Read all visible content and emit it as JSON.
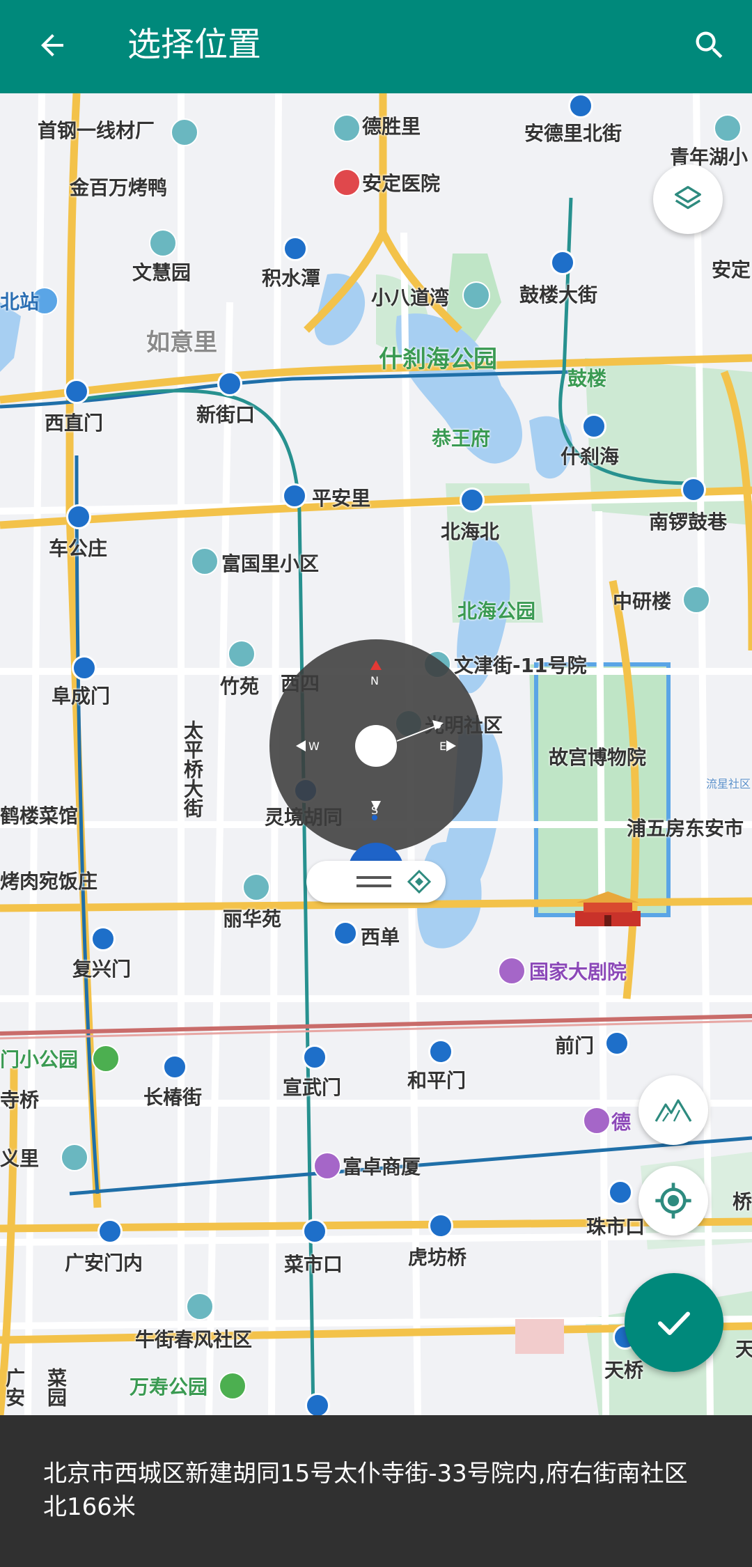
{
  "app_bar": {
    "title": "选择位置",
    "back_icon": "arrow-left-icon",
    "search_icon": "search-icon"
  },
  "map": {
    "labels": [
      {
        "text": "首钢一线材厂",
        "cls": ""
      },
      {
        "text": "德胜里",
        "cls": ""
      },
      {
        "text": "安德里北街",
        "cls": ""
      },
      {
        "text": "青年湖小",
        "cls": ""
      },
      {
        "text": "金百万烤鸭",
        "cls": ""
      },
      {
        "text": "安定医院",
        "cls": ""
      },
      {
        "text": "文慧园",
        "cls": ""
      },
      {
        "text": "积水潭",
        "cls": ""
      },
      {
        "text": "小八道湾",
        "cls": ""
      },
      {
        "text": "鼓楼大街",
        "cls": ""
      },
      {
        "text": "安定",
        "cls": ""
      },
      {
        "text": "北站",
        "cls": "blue"
      },
      {
        "text": "如意里",
        "cls": "gray"
      },
      {
        "text": "什刹海公园",
        "cls": "green big"
      },
      {
        "text": "鼓楼",
        "cls": "green"
      },
      {
        "text": "西直门",
        "cls": ""
      },
      {
        "text": "新街口",
        "cls": ""
      },
      {
        "text": "恭王府",
        "cls": "green"
      },
      {
        "text": "什刹海",
        "cls": ""
      },
      {
        "text": "平安里",
        "cls": ""
      },
      {
        "text": "北海北",
        "cls": ""
      },
      {
        "text": "南锣鼓巷",
        "cls": ""
      },
      {
        "text": "车公庄",
        "cls": ""
      },
      {
        "text": "富国里小区",
        "cls": ""
      },
      {
        "text": "北海公园",
        "cls": "green"
      },
      {
        "text": "中研楼",
        "cls": ""
      },
      {
        "text": "竹苑",
        "cls": ""
      },
      {
        "text": "西四",
        "cls": ""
      },
      {
        "text": "文津街-11号院",
        "cls": ""
      },
      {
        "text": "阜成门",
        "cls": ""
      },
      {
        "text": "光明社区",
        "cls": ""
      },
      {
        "text": "故宫博物院",
        "cls": ""
      },
      {
        "text": "太平桥大街",
        "cls": "vert"
      },
      {
        "text": "鹤楼菜馆",
        "cls": ""
      },
      {
        "text": "灵境胡同",
        "cls": ""
      },
      {
        "text": "浦五房东安市",
        "cls": ""
      },
      {
        "text": "流星社区",
        "cls": "small-blue"
      },
      {
        "text": "烤肉宛饭庄",
        "cls": ""
      },
      {
        "text": "丽华苑",
        "cls": ""
      },
      {
        "text": "西单",
        "cls": ""
      },
      {
        "text": "复兴门",
        "cls": ""
      },
      {
        "text": "国家大剧院",
        "cls": "purple"
      },
      {
        "text": "门小公园",
        "cls": "green"
      },
      {
        "text": "长椿街",
        "cls": ""
      },
      {
        "text": "宣武门",
        "cls": ""
      },
      {
        "text": "和平门",
        "cls": ""
      },
      {
        "text": "前门",
        "cls": ""
      },
      {
        "text": "寺桥",
        "cls": ""
      },
      {
        "text": "德",
        "cls": "purple"
      },
      {
        "text": "义里",
        "cls": ""
      },
      {
        "text": "富卓商厦",
        "cls": ""
      },
      {
        "text": "珠市口",
        "cls": ""
      },
      {
        "text": "桥",
        "cls": ""
      },
      {
        "text": "广安门内",
        "cls": ""
      },
      {
        "text": "菜市口",
        "cls": ""
      },
      {
        "text": "虎坊桥",
        "cls": ""
      },
      {
        "text": "牛街春风社区",
        "cls": ""
      },
      {
        "text": "天桥",
        "cls": ""
      },
      {
        "text": "天",
        "cls": ""
      },
      {
        "text": "万寿公园",
        "cls": "green"
      },
      {
        "text": "广安",
        "cls": ""
      },
      {
        "text": "菜园",
        "cls": ""
      }
    ],
    "compass": {
      "north": "N",
      "south": "S",
      "east": "E",
      "west": "W"
    },
    "layers_icon": "layers-icon",
    "terrain_icon": "terrain-icon",
    "locate_icon": "my-location-icon",
    "confirm_icon": "check-icon"
  },
  "bottom_bar": {
    "address": "北京市西城区新建胡同15号太仆寺街-33号院内,府右街南社区北166米"
  },
  "colors": {
    "primary": "#00897b",
    "bottom": "#303030"
  }
}
